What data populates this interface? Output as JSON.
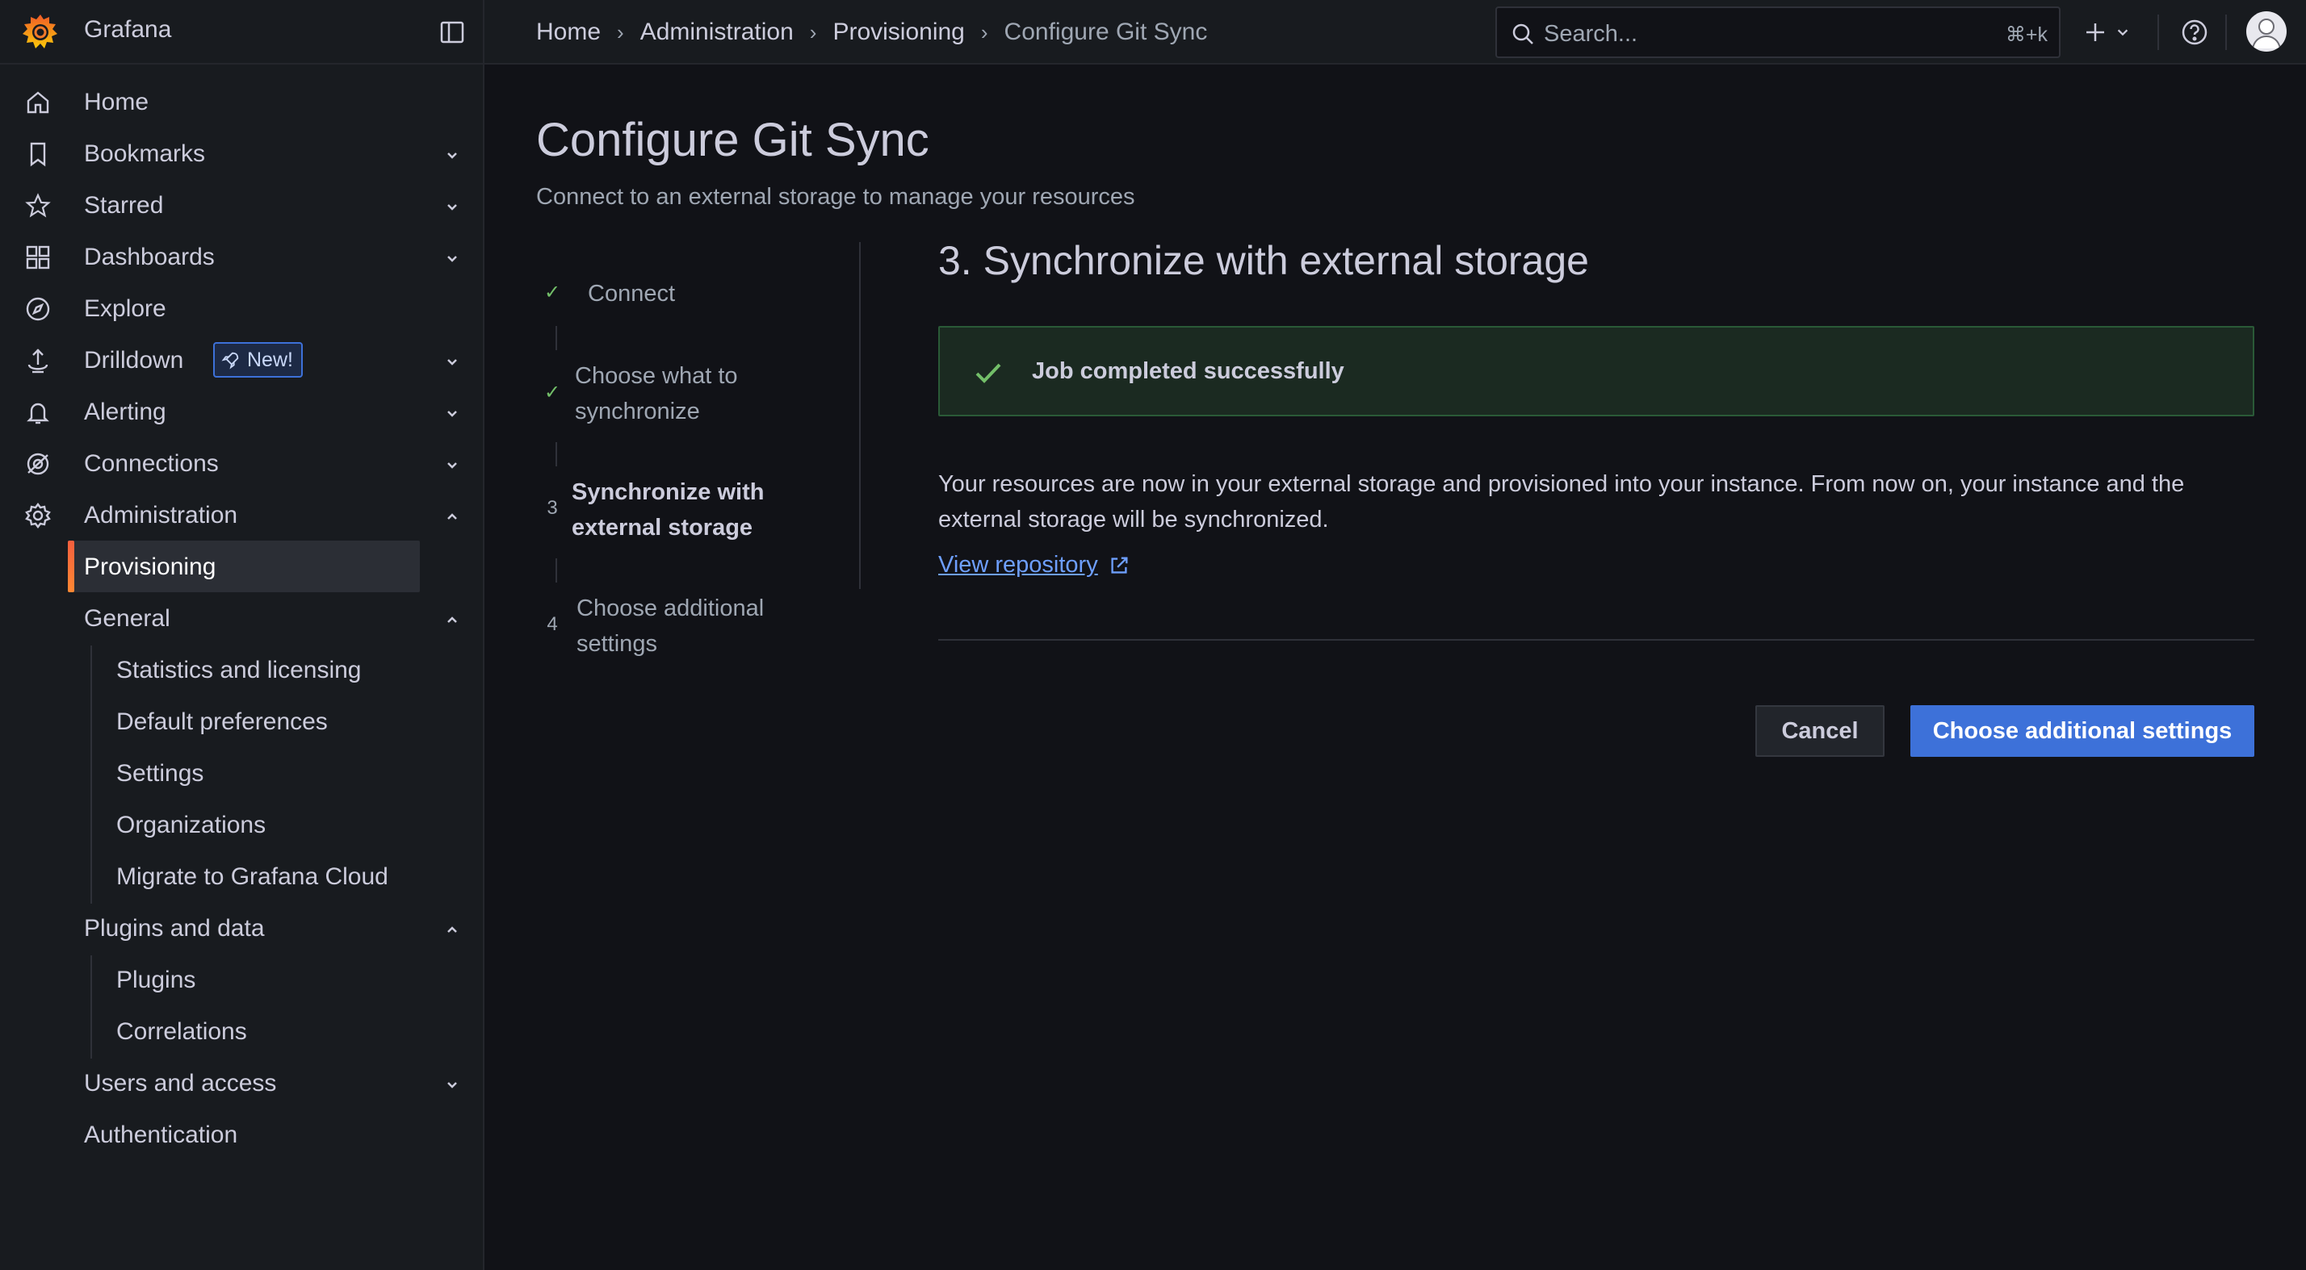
{
  "app": {
    "name": "Grafana"
  },
  "colors": {
    "accent": "#3d71d9",
    "success": "#73bf69",
    "link": "#6e9fff",
    "brand": "#f55f3e"
  },
  "breadcrumb": [
    "Home",
    "Administration",
    "Provisioning",
    "Configure Git Sync"
  ],
  "search": {
    "placeholder": "Search...",
    "shortcut": "⌘+k"
  },
  "sidebar": {
    "items": [
      {
        "label": "Home",
        "icon": "home-icon"
      },
      {
        "label": "Bookmarks",
        "icon": "bookmark-icon"
      },
      {
        "label": "Starred",
        "icon": "star-icon"
      },
      {
        "label": "Dashboards",
        "icon": "apps-icon"
      },
      {
        "label": "Explore",
        "icon": "compass-icon"
      },
      {
        "label": "Drilldown",
        "icon": "drilldown-icon",
        "badge": "New!"
      },
      {
        "label": "Alerting",
        "icon": "bell-icon"
      },
      {
        "label": "Connections",
        "icon": "connections-icon"
      },
      {
        "label": "Administration",
        "icon": "gear-icon"
      }
    ],
    "admin": {
      "provisioning": "Provisioning",
      "general": "General",
      "general_items": [
        "Statistics and licensing",
        "Default preferences",
        "Settings",
        "Organizations",
        "Migrate to Grafana Cloud"
      ],
      "plugins_and_data": "Plugins and data",
      "plugins_items": [
        "Plugins",
        "Correlations"
      ],
      "users_and_access": "Users and access",
      "authentication": "Authentication"
    }
  },
  "page": {
    "title": "Configure Git Sync",
    "subtitle": "Connect to an external storage to manage your resources"
  },
  "steps": [
    {
      "label": "Connect",
      "marker": "✓",
      "state": "done"
    },
    {
      "label": "Choose what to synchronize",
      "marker": "✓",
      "state": "done"
    },
    {
      "label": "Synchronize with external storage",
      "marker": "3",
      "state": "active"
    },
    {
      "label": "Choose additional settings",
      "marker": "4",
      "state": "pending"
    }
  ],
  "section": {
    "title": "3. Synchronize with external storage",
    "alert_title": "Job completed successfully",
    "body": "Your resources are now in your external storage and provisioned into your instance. From now on, your instance and the external storage will be synchronized.",
    "link_label": "View repository"
  },
  "actions": {
    "cancel": "Cancel",
    "next": "Choose additional settings"
  }
}
